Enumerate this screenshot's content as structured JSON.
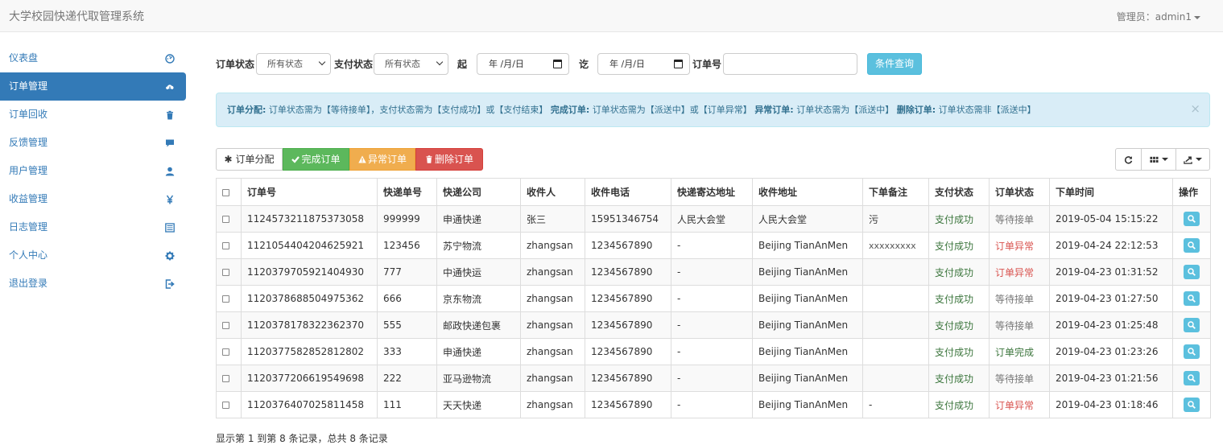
{
  "app": {
    "title": "大学校园快递代取管理系统",
    "user_label": "管理员：admin1"
  },
  "sidebar": {
    "items": [
      {
        "label": "仪表盘",
        "icon": "dashboard-icon"
      },
      {
        "label": "订单管理",
        "icon": "cloud-download-icon",
        "active": true
      },
      {
        "label": "订单回收",
        "icon": "trash-icon"
      },
      {
        "label": "反馈管理",
        "icon": "comment-icon"
      },
      {
        "label": "用户管理",
        "icon": "user-icon"
      },
      {
        "label": "收益管理",
        "icon": "yen-icon"
      },
      {
        "label": "日志管理",
        "icon": "list-alt-icon"
      },
      {
        "label": "个人中心",
        "icon": "cog-icon"
      },
      {
        "label": "退出登录",
        "icon": "logout-icon"
      }
    ]
  },
  "filters": {
    "order_status_label": "订单状态",
    "order_status_value": "所有状态",
    "pay_status_label": "支付状态",
    "pay_status_value": "所有状态",
    "from_label": "起",
    "from_value": "年 /月/日",
    "to_label": "讫",
    "to_value": "年 /月/日",
    "order_no_label": "订单号",
    "order_no_value": "",
    "search_button": "条件查询"
  },
  "alert": {
    "assign_label": "订单分配:",
    "assign_text": "订单状态需为【等待接单】，支付状态需为【支付成功】或【支付结束】",
    "complete_label": "完成订单:",
    "complete_text": "订单状态需为【派送中】或【订单异常】",
    "abnormal_label": "异常订单:",
    "abnormal_text": "订单状态需为【派送中】",
    "delete_label": "删除订单:",
    "delete_text": "订单状态需非【派送中】",
    "close": "×"
  },
  "toolbar": {
    "assign": "订单分配",
    "complete": "完成订单",
    "abnormal": "异常订单",
    "delete": "删除订单"
  },
  "colors": {
    "primary": "#337ab7",
    "info": "#5bc0de",
    "success": "#5cb85c",
    "warning": "#f0ad4e",
    "danger": "#d9534f"
  },
  "table": {
    "headers": [
      "订单号",
      "快递单号",
      "快递公司",
      "收件人",
      "收件电话",
      "快递寄达地址",
      "收件地址",
      "下单备注",
      "支付状态",
      "订单状态",
      "下单时间",
      "操作"
    ],
    "rows": [
      {
        "order_no": "1124573211875373058",
        "tracking": "999999",
        "company": "申通快递",
        "recipient": "张三",
        "phone": "15951346754",
        "origin": "人民大会堂",
        "address": "人民大会堂",
        "note": "污",
        "pay": "支付成功",
        "status": "等待接单",
        "status_type": "wait",
        "time": "2019-05-04 15:15:22"
      },
      {
        "order_no": "1121054404204625921",
        "tracking": "123456",
        "company": "苏宁物流",
        "recipient": "zhangsan",
        "phone": "1234567890",
        "origin": "-",
        "address": "Beijing TianAnMen",
        "note": "xxxxxxxxx",
        "pay": "支付成功",
        "status": "订单异常",
        "status_type": "err",
        "time": "2019-04-24 22:12:53"
      },
      {
        "order_no": "1120379705921404930",
        "tracking": "777",
        "company": "中通快运",
        "recipient": "zhangsan",
        "phone": "1234567890",
        "origin": "-",
        "address": "Beijing TianAnMen",
        "note": "",
        "pay": "支付成功",
        "status": "订单异常",
        "status_type": "err",
        "time": "2019-04-23 01:31:52"
      },
      {
        "order_no": "1120378688504975362",
        "tracking": "666",
        "company": "京东物流",
        "recipient": "zhangsan",
        "phone": "1234567890",
        "origin": "-",
        "address": "Beijing TianAnMen",
        "note": "",
        "pay": "支付成功",
        "status": "等待接单",
        "status_type": "wait",
        "time": "2019-04-23 01:27:50"
      },
      {
        "order_no": "1120378178322362370",
        "tracking": "555",
        "company": "邮政快递包裹",
        "recipient": "zhangsan",
        "phone": "1234567890",
        "origin": "-",
        "address": "Beijing TianAnMen",
        "note": "",
        "pay": "支付成功",
        "status": "等待接单",
        "status_type": "wait",
        "time": "2019-04-23 01:25:48"
      },
      {
        "order_no": "1120377582852812802",
        "tracking": "333",
        "company": "申通快递",
        "recipient": "zhangsan",
        "phone": "1234567890",
        "origin": "-",
        "address": "Beijing TianAnMen",
        "note": "",
        "pay": "支付成功",
        "status": "订单完成",
        "status_type": "ok",
        "time": "2019-04-23 01:23:26"
      },
      {
        "order_no": "1120377206619549698",
        "tracking": "222",
        "company": "亚马逊物流",
        "recipient": "zhangsan",
        "phone": "1234567890",
        "origin": "-",
        "address": "Beijing TianAnMen",
        "note": "",
        "pay": "支付成功",
        "status": "等待接单",
        "status_type": "wait",
        "time": "2019-04-23 01:21:56"
      },
      {
        "order_no": "1120376407025811458",
        "tracking": "111",
        "company": "天天快递",
        "recipient": "zhangsan",
        "phone": "1234567890",
        "origin": "-",
        "address": "Beijing TianAnMen",
        "note": "-",
        "pay": "支付成功",
        "status": "订单异常",
        "status_type": "err",
        "time": "2019-04-23 01:18:46"
      }
    ]
  },
  "footer": {
    "summary": "显示第 1 到第 8 条记录，总共 8 条记录"
  }
}
